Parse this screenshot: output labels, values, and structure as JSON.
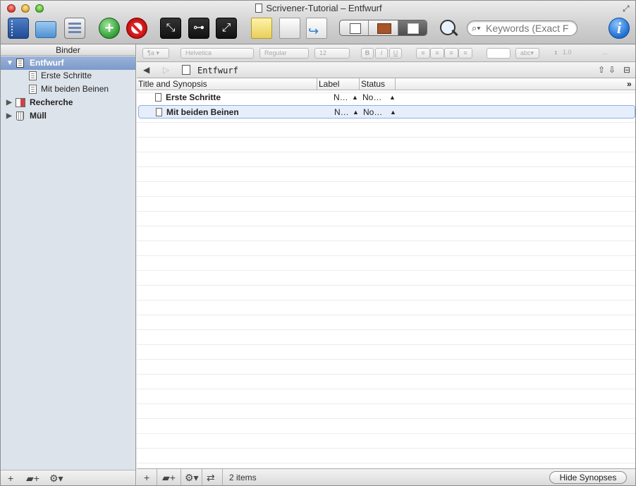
{
  "window": {
    "title": "Scrivener-Tutorial – Entfwurf"
  },
  "toolbar": {
    "search_placeholder": "Keywords (Exact F",
    "info_label": "i"
  },
  "binder": {
    "header": "Binder",
    "items": [
      {
        "label": "Entfwurf",
        "icon": "draft-folder-icon",
        "expanded": true,
        "selected": true
      },
      {
        "label": "Erste Schritte",
        "icon": "document-icon"
      },
      {
        "label": "Mit beiden Beinen",
        "icon": "document-icon"
      },
      {
        "label": "Recherche",
        "icon": "research-folder-icon",
        "expanded": false
      },
      {
        "label": "Müll",
        "icon": "trash-icon",
        "expanded": false
      }
    ]
  },
  "formatbar": {
    "paragraph": "¶a",
    "font": "Helvetica",
    "style": "Regular",
    "size": "12",
    "bold": "B",
    "italic": "I",
    "underline": "U",
    "highlight": "abc",
    "line_spacing": "1.0",
    "more": "..."
  },
  "header": {
    "title": "Entfwurf"
  },
  "outliner": {
    "columns": [
      "Title and Synopsis",
      "Label",
      "Status"
    ],
    "rows": [
      {
        "title": "Erste Schritte",
        "label": "N…",
        "status": "No…"
      },
      {
        "title": "Mit beiden Beinen",
        "label": "N…",
        "status": "No…",
        "selected": true
      }
    ]
  },
  "footer": {
    "count": "2 items",
    "hide_synopses": "Hide Synopses"
  },
  "colors": {
    "binder_bg": "#dde3ea",
    "binder_selection": "#7c9acb",
    "row_selection": "#e6eefb"
  }
}
